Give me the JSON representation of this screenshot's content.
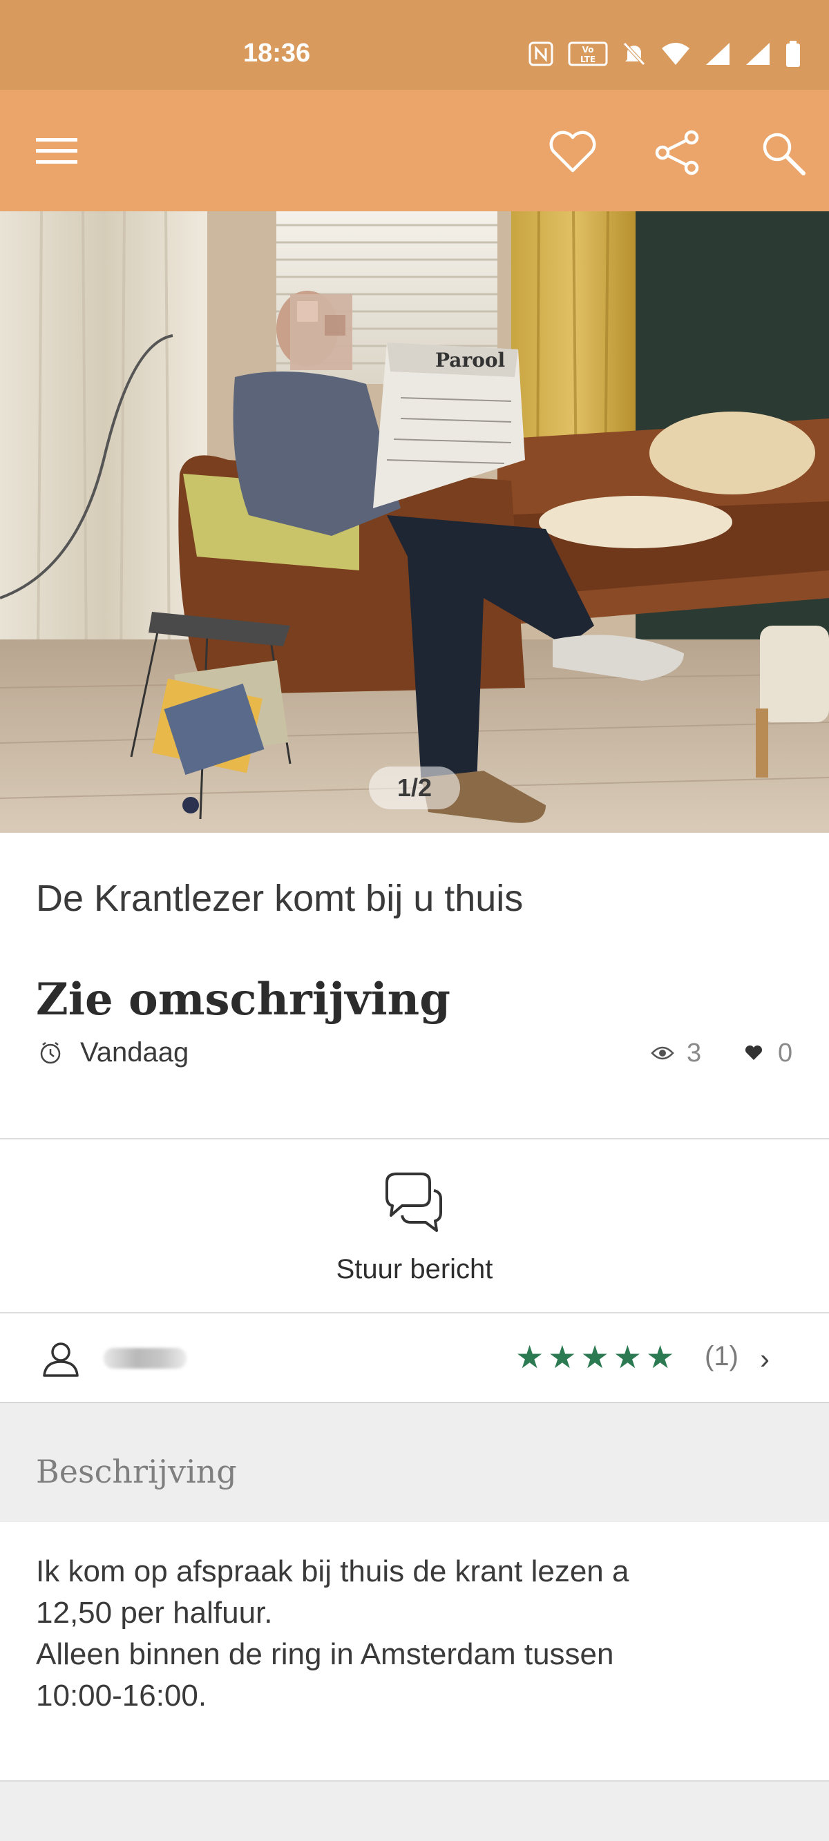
{
  "status_bar": {
    "time": "18:36",
    "icons": [
      "nfc-icon",
      "volte-icon",
      "mute-icon",
      "wifi-icon",
      "signal-icon",
      "signal-icon-2",
      "battery-icon"
    ]
  },
  "app_bar": {
    "menu_icon": "hamburger-menu-icon",
    "actions": [
      "heart-icon",
      "share-icon",
      "search-icon"
    ]
  },
  "hero": {
    "image_counter": "1/2"
  },
  "listing": {
    "title": "De Krantlezer komt bij u thuis",
    "price": "Zie omschrijving",
    "date": "Vandaag",
    "views": "3",
    "likes": "0"
  },
  "message": {
    "label": "Stuur bericht"
  },
  "seller": {
    "rating_stars": 5,
    "rating_count": "(1)"
  },
  "description_section": {
    "header": "Beschrijving",
    "lines": [
      "Ik kom op afspraak bij thuis de krant lezen a",
      "12,50 per halfuur.",
      "Alleen binnen de ring in Amsterdam tussen",
      "10:00-16:00."
    ]
  },
  "colors": {
    "status_bar": "#d99a5e",
    "app_bar": "#eba56a",
    "star_green": "#2b7a52"
  }
}
